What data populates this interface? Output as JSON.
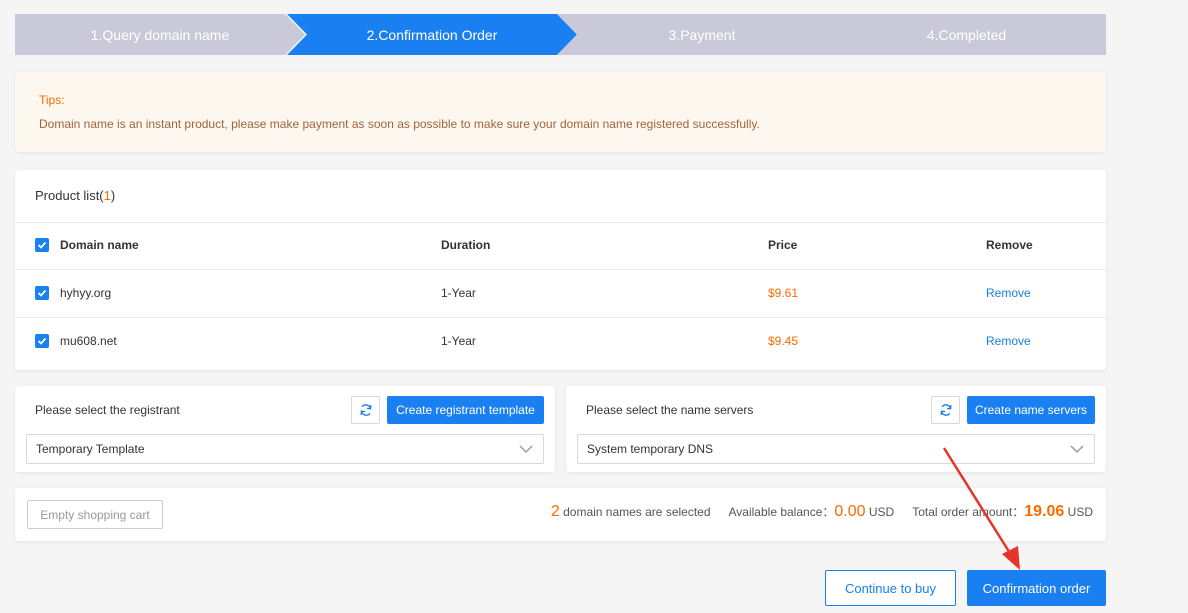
{
  "steps": [
    {
      "label": "1.Query domain name",
      "color": "#c9c9d9"
    },
    {
      "label": "2.Confirmation Order",
      "color": "#1a7ff0"
    },
    {
      "label": "3.Payment",
      "color": "#c9c9d9"
    },
    {
      "label": "4.Completed",
      "color": "#c9c9d9"
    }
  ],
  "tips": {
    "title": "Tips:",
    "text": "Domain name is an instant product, please make payment as soon as possible to make sure your domain name registered successfully."
  },
  "product_list": {
    "title": "Product list(",
    "count": "1",
    "title_end": ")",
    "headers": {
      "domain": "Domain name",
      "duration": "Duration",
      "price": "Price",
      "remove": "Remove"
    },
    "rows": [
      {
        "domain": "hyhyy.org",
        "duration": "1-Year",
        "price": "$9.61",
        "remove": "Remove",
        "checked": true
      },
      {
        "domain": "mu608.net",
        "duration": "1-Year",
        "price": "$9.45",
        "remove": "Remove",
        "checked": true
      }
    ]
  },
  "registrant": {
    "label": "Please select the registrant",
    "create_label": "Create registrant template",
    "selected": "Temporary Template",
    "refresh_icon": "refresh-icon"
  },
  "name_servers": {
    "label": "Please select the name servers",
    "create_label": "Create name servers",
    "selected": "System temporary DNS",
    "refresh_icon": "refresh-icon"
  },
  "summary": {
    "empty_cart_label": "Empty shopping cart",
    "selected_count": "2",
    "selected_text": "domain names are selected",
    "balance_label": "Available balance：",
    "balance_value": "0.00",
    "balance_unit": "USD",
    "total_label": "Total order amount：",
    "total_value": "19.06",
    "total_unit": "USD"
  },
  "actions": {
    "continue_label": "Continue to buy",
    "confirm_label": "Confirmation order"
  },
  "colors": {
    "accent": "#1a7ff0",
    "price": "#ff6a00",
    "annotation_arrow": "#e8332a"
  }
}
